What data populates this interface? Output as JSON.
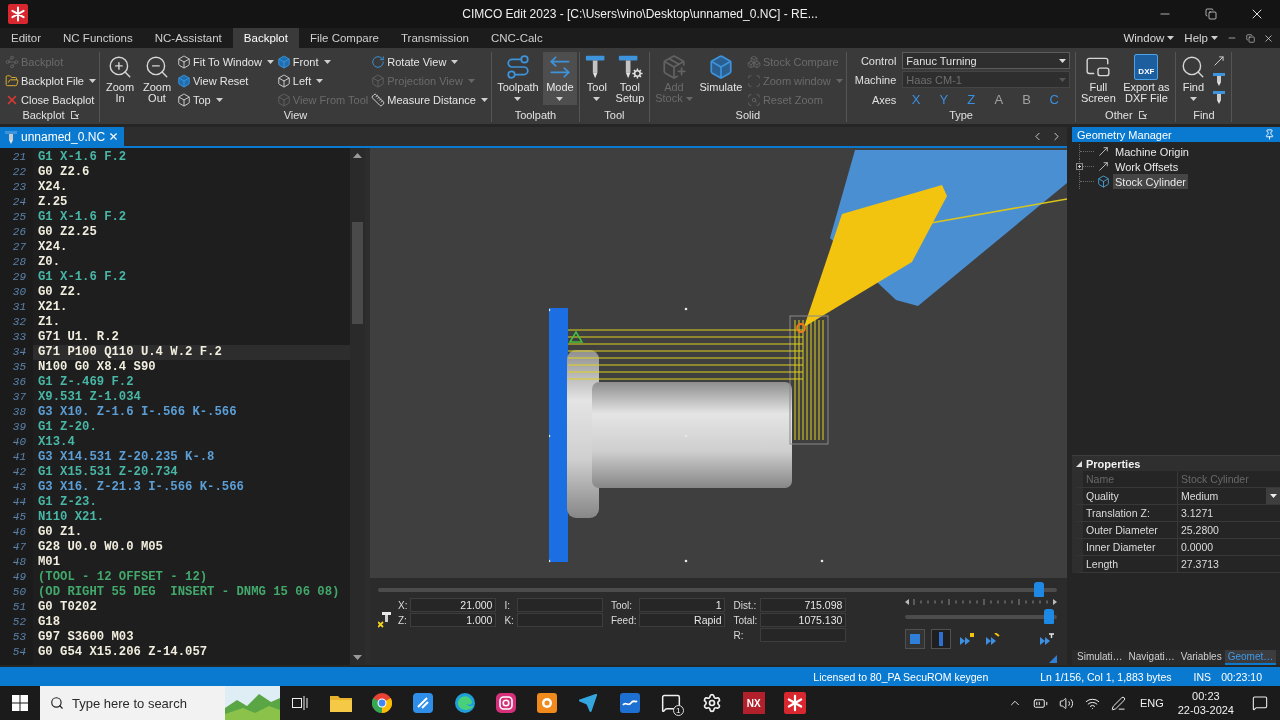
{
  "window": {
    "title": "CIMCO Edit 2023 - [C:\\Users\\vino\\Desktop\\unnamed_0.NC] - RE..."
  },
  "menu_tabs": [
    {
      "label": "Editor",
      "selected": false
    },
    {
      "label": "NC Functions",
      "selected": false
    },
    {
      "label": "NC-Assistant",
      "selected": false
    },
    {
      "label": "Backplot",
      "selected": true
    },
    {
      "label": "File Compare",
      "selected": false
    },
    {
      "label": "Transmission",
      "selected": false
    },
    {
      "label": "CNC-Calc",
      "selected": false
    }
  ],
  "menu_right": [
    {
      "label": "Window"
    },
    {
      "label": "Help"
    }
  ],
  "ribbon": [
    {
      "label": "Backplot",
      "launcher": true,
      "columns": [
        {
          "kind": "stack",
          "items": [
            {
              "label": "Backplot",
              "disabled": true,
              "dropdown": false
            },
            {
              "label": "Backplot File",
              "disabled": false,
              "dropdown": true
            },
            {
              "label": "Close Backplot",
              "disabled": false,
              "dropdown": false
            }
          ]
        }
      ]
    },
    {
      "label": "View",
      "launcher": false,
      "columns": [
        {
          "kind": "large",
          "items": [
            {
              "label": "Zoom In",
              "disabled": false,
              "dropdown": false
            }
          ]
        },
        {
          "kind": "large",
          "items": [
            {
              "label": "Zoom Out",
              "disabled": false,
              "dropdown": false
            }
          ]
        },
        {
          "kind": "stack",
          "items": [
            {
              "label": "Fit To Window",
              "disabled": false,
              "dropdown": true
            },
            {
              "label": "View Reset",
              "disabled": false,
              "dropdown": false
            },
            {
              "label": "Top",
              "disabled": false,
              "dropdown": true
            }
          ]
        },
        {
          "kind": "stack",
          "items": [
            {
              "label": "Front",
              "disabled": false,
              "dropdown": true
            },
            {
              "label": "Left",
              "disabled": false,
              "dropdown": true
            },
            {
              "label": "View From Tool",
              "disabled": true,
              "dropdown": false
            }
          ]
        },
        {
          "kind": "stack",
          "items": [
            {
              "label": "Rotate View",
              "disabled": false,
              "dropdown": true
            },
            {
              "label": "Projection View",
              "disabled": true,
              "dropdown": true
            },
            {
              "label": "Measure Distance",
              "disabled": false,
              "dropdown": true
            }
          ]
        }
      ]
    },
    {
      "label": "Toolpath",
      "launcher": false,
      "columns": [
        {
          "kind": "large",
          "items": [
            {
              "label": "Toolpath",
              "disabled": false,
              "dropdown": true,
              "selected": false
            }
          ]
        },
        {
          "kind": "large",
          "items": [
            {
              "label": "Mode",
              "disabled": false,
              "dropdown": true,
              "selected": true
            }
          ]
        }
      ]
    },
    {
      "label": "Tool",
      "launcher": false,
      "columns": [
        {
          "kind": "large",
          "items": [
            {
              "label": "Tool",
              "disabled": false,
              "dropdown": true
            }
          ]
        },
        {
          "kind": "large",
          "items": [
            {
              "label": "Tool Setup",
              "disabled": false,
              "dropdown": false
            }
          ]
        }
      ]
    },
    {
      "label": "Solid",
      "launcher": false,
      "columns": [
        {
          "kind": "large",
          "items": [
            {
              "label": "Add Stock",
              "disabled": true,
              "dropdown": true
            }
          ]
        },
        {
          "kind": "large",
          "items": [
            {
              "label": "Simulate",
              "disabled": false,
              "dropdown": false
            }
          ]
        },
        {
          "kind": "stack",
          "items": [
            {
              "label": "Stock Compare",
              "disabled": true,
              "dropdown": false
            },
            {
              "label": "Zoom window",
              "disabled": true,
              "dropdown": true
            },
            {
              "label": "Reset Zoom",
              "disabled": true,
              "dropdown": false
            }
          ]
        }
      ]
    },
    {
      "label": "Type",
      "launcher": false,
      "columns": [
        {
          "kind": "form",
          "fields": [
            {
              "label": "Control",
              "value": "Fanuc Turning",
              "disabled": false
            },
            {
              "label": "Machine",
              "value": "Haas CM-1",
              "disabled": true
            }
          ],
          "axes_label": "Axes",
          "axes": [
            {
              "label": "X",
              "on": true
            },
            {
              "label": "Y",
              "on": true
            },
            {
              "label": "Z",
              "on": true
            },
            {
              "label": "A",
              "on": false
            },
            {
              "label": "B",
              "on": false
            },
            {
              "label": "C",
              "on": true
            }
          ]
        }
      ]
    },
    {
      "label": "Other",
      "launcher": true,
      "columns": [
        {
          "kind": "large",
          "items": [
            {
              "label": "Full Screen",
              "disabled": false,
              "dropdown": false
            }
          ]
        },
        {
          "kind": "large",
          "items": [
            {
              "label": "Export as DXF File",
              "disabled": false,
              "dropdown": false,
              "icon_text": "DXF"
            }
          ]
        }
      ]
    },
    {
      "label": "Find",
      "launcher": false,
      "columns": [
        {
          "kind": "large",
          "items": [
            {
              "label": "Find",
              "disabled": false,
              "dropdown": true
            }
          ]
        },
        {
          "kind": "tool_icons"
        }
      ]
    }
  ],
  "editor": {
    "tab": {
      "label": "unnamed_0.NC",
      "selected": true
    },
    "lines": [
      {
        "number": "21",
        "code": "G1 X-1.6 F.2",
        "kind": "feed",
        "current": false
      },
      {
        "number": "22",
        "code": "G0 Z2.6",
        "kind": "plain",
        "current": false
      },
      {
        "number": "23",
        "code": "X24.",
        "kind": "plain",
        "current": false
      },
      {
        "number": "24",
        "code": "Z.25",
        "kind": "plain",
        "current": false
      },
      {
        "number": "25",
        "code": "G1 X-1.6 F.2",
        "kind": "feed",
        "current": false
      },
      {
        "number": "26",
        "code": "G0 Z2.25",
        "kind": "plain",
        "current": false
      },
      {
        "number": "27",
        "code": "X24.",
        "kind": "plain",
        "current": false
      },
      {
        "number": "28",
        "code": "Z0.",
        "kind": "plain",
        "current": false
      },
      {
        "number": "29",
        "code": "G1 X-1.6 F.2",
        "kind": "feed",
        "current": false
      },
      {
        "number": "30",
        "code": "G0 Z2.",
        "kind": "plain",
        "current": false
      },
      {
        "number": "31",
        "code": "X21.",
        "kind": "plain",
        "current": false
      },
      {
        "number": "32",
        "code": "Z1.",
        "kind": "plain",
        "current": false
      },
      {
        "number": "33",
        "code": "G71 U1. R.2",
        "kind": "plain",
        "current": false
      },
      {
        "number": "34",
        "code": "G71 P100 Q110 U.4 W.2 F.2",
        "kind": "plain",
        "current": true
      },
      {
        "number": "35",
        "code": "N100 G0 X8.4 S90",
        "kind": "plain",
        "current": false
      },
      {
        "number": "36",
        "code": "G1 Z-.469 F.2",
        "kind": "feed",
        "current": false
      },
      {
        "number": "37",
        "code": "X9.531 Z-1.034",
        "kind": "feed",
        "current": false
      },
      {
        "number": "38",
        "code": "G3 X10. Z-1.6 I-.566 K-.566",
        "kind": "arc",
        "current": false
      },
      {
        "number": "39",
        "code": "G1 Z-20.",
        "kind": "feed",
        "current": false
      },
      {
        "number": "40",
        "code": "X13.4",
        "kind": "feed",
        "current": false
      },
      {
        "number": "41",
        "code": "G3 X14.531 Z-20.235 K-.8",
        "kind": "arc",
        "current": false
      },
      {
        "number": "42",
        "code": "G1 X15.531 Z-20.734",
        "kind": "feed",
        "current": false
      },
      {
        "number": "43",
        "code": "G3 X16. Z-21.3 I-.566 K-.566",
        "kind": "arc",
        "current": false
      },
      {
        "number": "44",
        "code": "G1 Z-23.",
        "kind": "feed",
        "current": false
      },
      {
        "number": "45",
        "code": "N110 X21.",
        "kind": "feed",
        "current": false
      },
      {
        "number": "46",
        "code": "G0 Z1.",
        "kind": "plain",
        "current": false
      },
      {
        "number": "47",
        "code": "G28 U0.0 W0.0 M05",
        "kind": "plain",
        "current": false
      },
      {
        "number": "48",
        "code": "M01",
        "kind": "plain",
        "current": false
      },
      {
        "number": "49",
        "code": "(TOOL - 12 OFFSET - 12)",
        "kind": "comment",
        "current": false
      },
      {
        "number": "50",
        "code": "(OD RIGHT 55 DEG  INSERT - DNMG 15 06 08)",
        "kind": "comment",
        "current": false
      },
      {
        "number": "51",
        "code": "G0 T0202",
        "kind": "plain",
        "current": false
      },
      {
        "number": "52",
        "code": "G18",
        "kind": "plain",
        "current": false
      },
      {
        "number": "53",
        "code": "G97 S3600 M03",
        "kind": "plain",
        "current": false
      },
      {
        "number": "54",
        "code": "G0 G54 X15.206 Z-14.057",
        "kind": "plain",
        "current": false
      }
    ]
  },
  "backplot": {
    "timeline": {
      "level": 0.98
    },
    "readout_columns": [
      {
        "rows": [
          {
            "label": "X:",
            "value": "21.000"
          },
          {
            "label": "Z:",
            "value": "1.000"
          }
        ]
      },
      {
        "rows": [
          {
            "label": "I:"
          },
          {
            "label": "K:"
          }
        ]
      },
      {
        "rows": [
          {
            "label": "Tool:",
            "value": "1"
          },
          {
            "label": "Feed:",
            "value": "Rapid"
          }
        ]
      },
      {
        "rows": [
          {
            "label": "Dist.:",
            "value": "715.098"
          },
          {
            "label": "Total:",
            "value": "1075.130"
          },
          {
            "label": "R:"
          }
        ]
      }
    ],
    "speed": {
      "level": 0.98
    },
    "playback": [
      {
        "selected": false
      },
      {
        "selected": true
      },
      {
        "selected": false
      },
      {
        "selected": false
      },
      {
        "selected": false
      }
    ]
  },
  "geometry_manager": {
    "title": "Geometry Manager",
    "items": [
      {
        "label": "Machine Origin",
        "kind": "axis",
        "selected": false,
        "collapsed": false
      },
      {
        "label": "Work Offsets",
        "kind": "axis",
        "selected": false,
        "collapsed": true
      },
      {
        "label": "Stock Cylinder",
        "kind": "solid",
        "selected": true,
        "collapsed": false
      }
    ]
  },
  "properties": {
    "title": "Properties",
    "expanded": true,
    "rows": [
      {
        "name": "Name",
        "value": "Stock Cylinder",
        "readonly": true,
        "dropdown": false
      },
      {
        "name": "Quality",
        "value": "Medium",
        "readonly": false,
        "dropdown": true
      },
      {
        "name": "Translation Z:",
        "value": "3.1271",
        "readonly": false,
        "dropdown": false
      },
      {
        "name": "Outer Diameter",
        "value": "25.2800",
        "readonly": false,
        "dropdown": false
      },
      {
        "name": "Inner Diameter",
        "value": "0.0000",
        "readonly": false,
        "dropdown": false
      },
      {
        "name": "Length",
        "value": "27.3713",
        "readonly": false,
        "dropdown": false
      }
    ]
  },
  "panel_tabs": [
    {
      "label": "Simulati…",
      "selected": false
    },
    {
      "label": "Navigati…",
      "selected": false
    },
    {
      "label": "Variables",
      "selected": false
    },
    {
      "label": "Geomet…",
      "selected": true
    }
  ],
  "status_bar": {
    "license": "Licensed to 80_PA SecuROM keygen",
    "position": "Ln 1/156, Col 1, 1,883 bytes",
    "mode": "INS",
    "clock": "00:23:10"
  },
  "taskbar": {
    "search": {
      "placeholder": "Type here to search"
    },
    "chat_badge": "1",
    "logo_text": "NX",
    "language": "ENG",
    "time": "00:23",
    "date": "22-03-2024"
  }
}
